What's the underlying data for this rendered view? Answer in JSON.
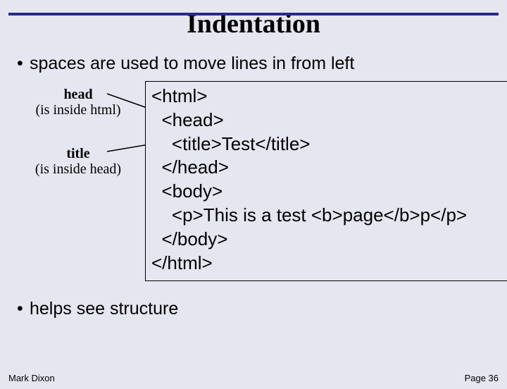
{
  "title": "Indentation",
  "bullets": {
    "first": "spaces are used to move lines in from left",
    "second": "helps see structure"
  },
  "labels": {
    "head_bold": "head",
    "head_sub": "(is inside html)",
    "title_bold": "title",
    "title_sub": "(is inside head)"
  },
  "code": {
    "l1": "<html>",
    "l2": "  <head>",
    "l3": "    <title>Test</title>",
    "l4": "  </head>",
    "l5": "  <body>",
    "l6": "    <p>This is a test <b>page</b>p</p>",
    "l7": "  </body>",
    "l8": "</html>"
  },
  "footer": {
    "author": "Mark Dixon",
    "page": "Page 36"
  }
}
